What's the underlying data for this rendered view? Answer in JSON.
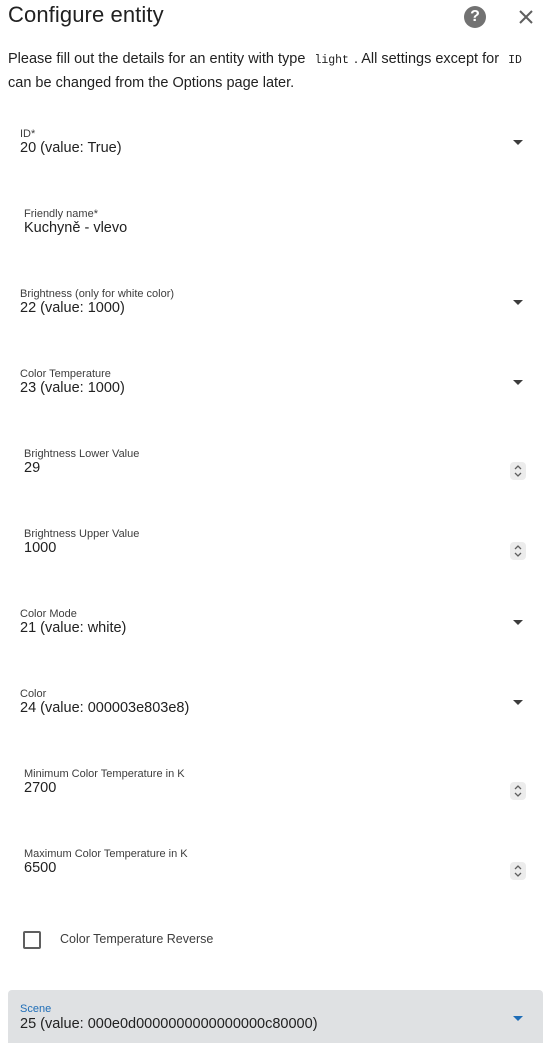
{
  "dialog": {
    "title": "Configure entity",
    "description_before": "Please fill out the details for an entity with type",
    "entity_type": "light",
    "description_middle": ". All settings except for",
    "id_code": "ID",
    "description_after": "can be changed from the Options page later."
  },
  "fields": {
    "id": {
      "label": "ID*",
      "value": "20 (value: True)"
    },
    "friendly_name": {
      "label": "Friendly name*",
      "value": "Kuchyně - vlevo"
    },
    "brightness": {
      "label": "Brightness (only for white color)",
      "value": "22 (value: 1000)"
    },
    "color_temperature": {
      "label": "Color Temperature",
      "value": "23 (value: 1000)"
    },
    "brightness_lower": {
      "label": "Brightness Lower Value",
      "value": "29"
    },
    "brightness_upper": {
      "label": "Brightness Upper Value",
      "value": "1000"
    },
    "color_mode": {
      "label": "Color Mode",
      "value": "21 (value: white)"
    },
    "color": {
      "label": "Color",
      "value": "24 (value: 000003e803e8)"
    },
    "min_color_temp": {
      "label": "Minimum Color Temperature in K",
      "value": "2700"
    },
    "max_color_temp": {
      "label": "Maximum Color Temperature in K",
      "value": "6500"
    },
    "color_temp_reverse": {
      "label": "Color Temperature Reverse",
      "checked": false
    },
    "scene": {
      "label": "Scene",
      "value": "25 (value: 000e0d0000000000000000c80000)"
    }
  },
  "icons": {
    "help": "help-circle-icon",
    "close": "close-icon"
  },
  "colors": {
    "accent": "#1e6db7",
    "focused_bg": "#dfe1e3"
  }
}
